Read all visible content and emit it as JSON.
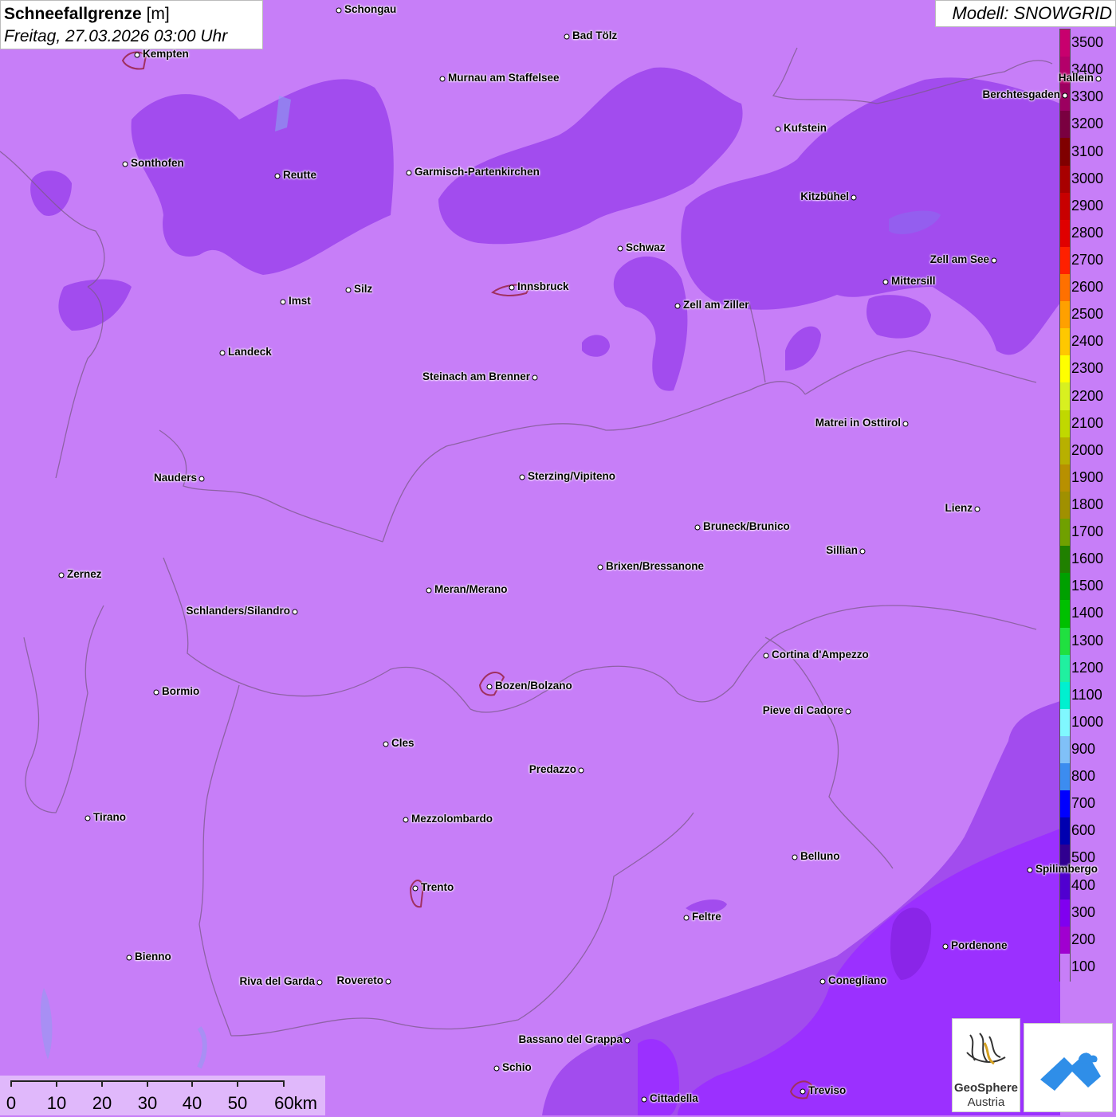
{
  "title": {
    "main": "Schneefallgrenze",
    "unit": "[m]",
    "datetime": "Freitag, 27.03.2026 03:00 Uhr"
  },
  "model": "Modell: SNOWGRID",
  "legend": {
    "labels": [
      "3500",
      "3400",
      "3300",
      "3200",
      "3100",
      "3000",
      "2900",
      "2800",
      "2700",
      "2600",
      "2500",
      "2400",
      "2300",
      "2200",
      "2100",
      "2000",
      "1900",
      "1800",
      "1700",
      "1600",
      "1500",
      "1400",
      "1300",
      "1200",
      "1100",
      "1000",
      "900",
      "800",
      "700",
      "600",
      "500",
      "400",
      "300",
      "200",
      "100"
    ],
    "colors": [
      "#c8006e",
      "#b4006a",
      "#9c0060",
      "#7a0040",
      "#800000",
      "#a80000",
      "#c80000",
      "#e00000",
      "#ff2000",
      "#ff7000",
      "#ffa000",
      "#ffc800",
      "#ffff00",
      "#d8f020",
      "#c0d800",
      "#b8b000",
      "#b89000",
      "#a09000",
      "#70a000",
      "#208000",
      "#00a000",
      "#00c000",
      "#20e040",
      "#20f0a0",
      "#00f0d0",
      "#80f8ff",
      "#80c0f8",
      "#3c8cf0",
      "#0000ff",
      "#0000b0",
      "#300090",
      "#5000d0",
      "#8000f0",
      "#a000d0",
      "#c77ef8"
    ]
  },
  "cities": [
    {
      "name": "Schongau",
      "side": "r"
    },
    {
      "name": "Bad Tölz",
      "side": "r"
    },
    {
      "name": "Kempten",
      "side": "r"
    },
    {
      "name": "Murnau am Staffelsee",
      "side": "r"
    },
    {
      "name": "Hallein",
      "side": "l"
    },
    {
      "name": "Berchtesgaden",
      "side": "l"
    },
    {
      "name": "Kufstein",
      "side": "r"
    },
    {
      "name": "Sonthofen",
      "side": "r"
    },
    {
      "name": "Reutte",
      "side": "r"
    },
    {
      "name": "Garmisch-Partenkirchen",
      "side": "r"
    },
    {
      "name": "Kitzbühel",
      "side": "l"
    },
    {
      "name": "Schwaz",
      "side": "r"
    },
    {
      "name": "Zell am See",
      "side": "l"
    },
    {
      "name": "Mittersill",
      "side": "r"
    },
    {
      "name": "Innsbruck",
      "side": "r"
    },
    {
      "name": "Silz",
      "side": "r"
    },
    {
      "name": "Imst",
      "side": "r"
    },
    {
      "name": "Zell am Ziller",
      "side": "r"
    },
    {
      "name": "Landeck",
      "side": "r"
    },
    {
      "name": "Steinach am Brenner",
      "side": "l"
    },
    {
      "name": "Matrei in Osttirol",
      "side": "l"
    },
    {
      "name": "Nauders",
      "side": "l"
    },
    {
      "name": "Sterzing/Vipiteno",
      "side": "r"
    },
    {
      "name": "Lienz",
      "side": "l"
    },
    {
      "name": "Bruneck/Brunico",
      "side": "r"
    },
    {
      "name": "Sillian",
      "side": "l"
    },
    {
      "name": "Brixen/Bressanone",
      "side": "r"
    },
    {
      "name": "Zernez",
      "side": "r"
    },
    {
      "name": "Meran/Merano",
      "side": "r"
    },
    {
      "name": "Schlanders/Silandro",
      "side": "l"
    },
    {
      "name": "Cortina d'Ampezzo",
      "side": "r"
    },
    {
      "name": "Bozen/Bolzano",
      "side": "r"
    },
    {
      "name": "Bormio",
      "side": "r"
    },
    {
      "name": "Pieve di Cadore",
      "side": "l"
    },
    {
      "name": "Cles",
      "side": "r"
    },
    {
      "name": "Predazzo",
      "side": "l"
    },
    {
      "name": "Tirano",
      "side": "r"
    },
    {
      "name": "Mezzolombardo",
      "side": "r"
    },
    {
      "name": "Belluno",
      "side": "r"
    },
    {
      "name": "Spilimbergo",
      "side": "r"
    },
    {
      "name": "Trento",
      "side": "r"
    },
    {
      "name": "Feltre",
      "side": "r"
    },
    {
      "name": "Pordenone",
      "side": "r"
    },
    {
      "name": "Bienno",
      "side": "r"
    },
    {
      "name": "Riva del Garda",
      "side": "l"
    },
    {
      "name": "Rovereto",
      "side": "l"
    },
    {
      "name": "Conegliano",
      "side": "r"
    },
    {
      "name": "Bassano del Grappa",
      "side": "l"
    },
    {
      "name": "Schio",
      "side": "r"
    },
    {
      "name": "Treviso",
      "side": "r"
    },
    {
      "name": "Cittadella",
      "side": "r"
    }
  ],
  "scale": {
    "labels": [
      "0",
      "10",
      "20",
      "30",
      "40",
      "50",
      "60km"
    ]
  },
  "logos": {
    "geosphere_line1": "GeoSphere",
    "geosphere_line2": "Austria"
  },
  "colors": {
    "base_snowline": "#c77ef8",
    "mid_snowline": "#a24cee",
    "low_snowline": "#9b30ff",
    "lowest_snowline": "#8a25e8",
    "border": "#6a5a7a"
  }
}
